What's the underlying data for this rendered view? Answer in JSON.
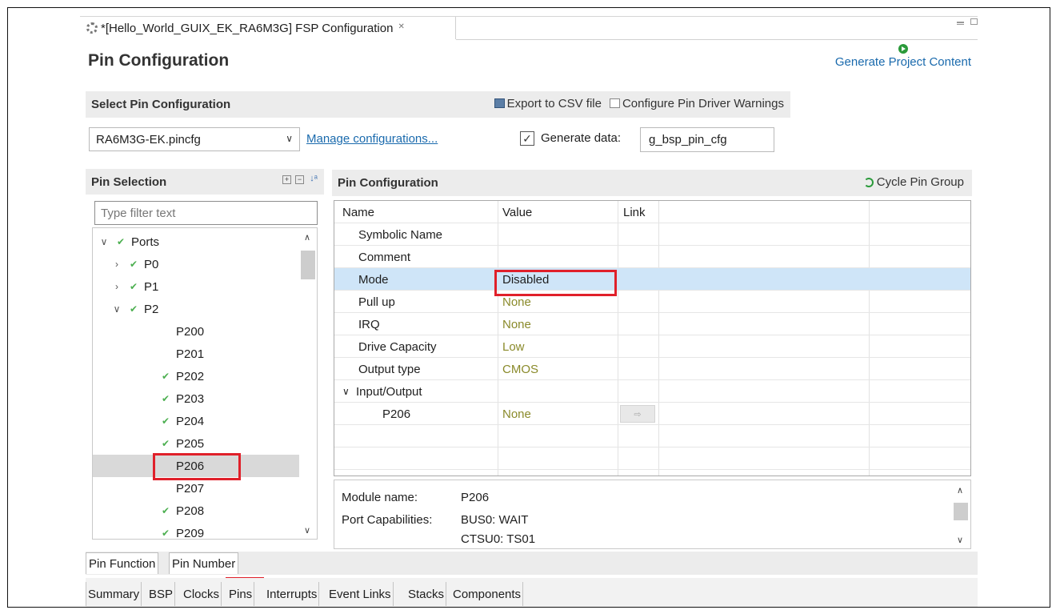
{
  "editor": {
    "tab_title": "*[Hello_World_GUIX_EK_RA6M3G] FSP Configuration",
    "close_glyph": "✕"
  },
  "header": {
    "title": "Pin Configuration",
    "generate_label": "Generate Project Content"
  },
  "select_section": {
    "title": "Select Pin Configuration",
    "export_label": "Export to CSV file",
    "warnings_label": "Configure Pin Driver Warnings",
    "config_value": "RA6M3G-EK.pincfg",
    "manage_label": "Manage configurations...",
    "generate_data_label": "Generate data:",
    "generate_data_checked": true,
    "generate_data_value": "g_bsp_pin_cfg"
  },
  "pin_selection": {
    "title": "Pin Selection",
    "filter_placeholder": "Type filter text",
    "tree": [
      {
        "label": "Ports",
        "level": 0,
        "twisty": "expanded",
        "check": true
      },
      {
        "label": "P0",
        "level": 1,
        "twisty": "collapsed",
        "check": true
      },
      {
        "label": "P1",
        "level": 1,
        "twisty": "collapsed",
        "check": true
      },
      {
        "label": "P2",
        "level": 1,
        "twisty": "expanded",
        "check": true
      },
      {
        "label": "P200",
        "level": 2,
        "twisty": "none",
        "check": false
      },
      {
        "label": "P201",
        "level": 2,
        "twisty": "none",
        "check": false
      },
      {
        "label": "P202",
        "level": 2,
        "twisty": "none",
        "check": true
      },
      {
        "label": "P203",
        "level": 2,
        "twisty": "none",
        "check": true
      },
      {
        "label": "P204",
        "level": 2,
        "twisty": "none",
        "check": true
      },
      {
        "label": "P205",
        "level": 2,
        "twisty": "none",
        "check": true
      },
      {
        "label": "P206",
        "level": 2,
        "twisty": "none",
        "check": false,
        "selected": true
      },
      {
        "label": "P207",
        "level": 2,
        "twisty": "none",
        "check": false
      },
      {
        "label": "P208",
        "level": 2,
        "twisty": "none",
        "check": true
      },
      {
        "label": "P209",
        "level": 2,
        "twisty": "none",
        "check": true
      }
    ]
  },
  "pin_config": {
    "title": "Pin Configuration",
    "cycle_label": "Cycle Pin Group",
    "columns": {
      "name": "Name",
      "value": "Value",
      "link": "Link"
    },
    "rows": [
      {
        "name": "Symbolic Name",
        "value": ""
      },
      {
        "name": "Comment",
        "value": ""
      },
      {
        "name": "Mode",
        "value": "Disabled"
      },
      {
        "name": "Pull up",
        "value": "None"
      },
      {
        "name": "IRQ",
        "value": "None"
      },
      {
        "name": "Drive Capacity",
        "value": "Low"
      },
      {
        "name": "Output type",
        "value": "CMOS"
      },
      {
        "name": "Input/Output",
        "value": ""
      },
      {
        "name": "P206",
        "value": "None"
      }
    ],
    "link_glyph": "⇨"
  },
  "info": {
    "module_label": "Module name:",
    "module_value": "P206",
    "caps_label": "Port Capabilities:",
    "caps_values": [
      "BUS0: WAIT",
      "CTSU0: TS01"
    ]
  },
  "sub_tabs": [
    "Pin Function",
    "Pin Number"
  ],
  "bottom_tabs": [
    "Summary",
    "BSP",
    "Clocks",
    "Pins",
    "Interrupts",
    "Event Links",
    "Stacks",
    "Components"
  ],
  "colors": {
    "highlight_box": "#e0202a",
    "selected_row": "#cfe5f8",
    "value_olive": "#8a8a2a",
    "link_blue": "#1a6aad"
  }
}
